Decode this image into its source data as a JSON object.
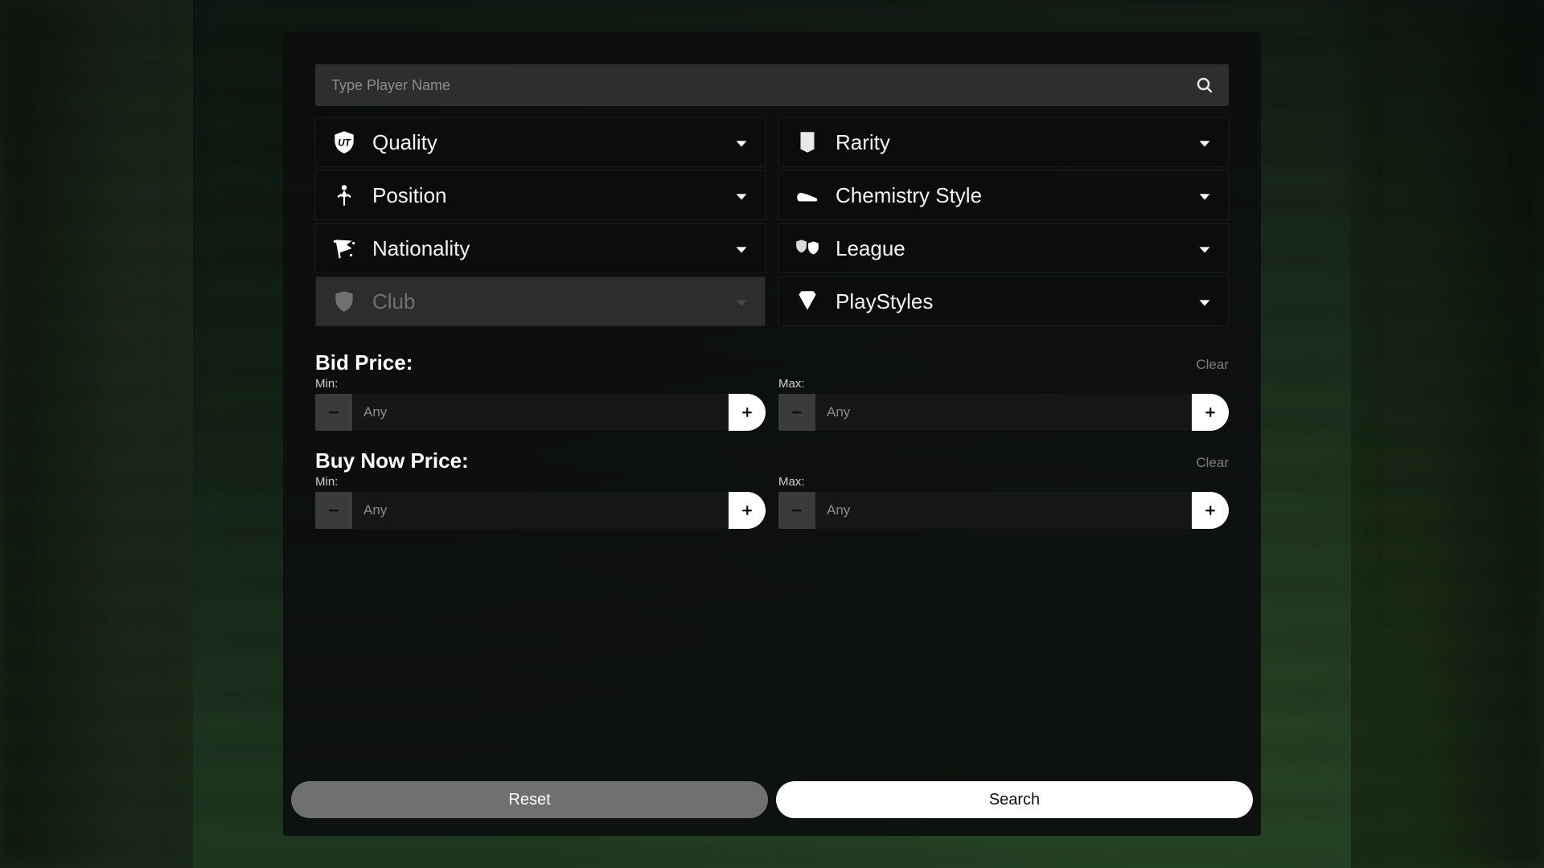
{
  "search": {
    "placeholder": "Type Player Name"
  },
  "filters": {
    "quality": {
      "label": "Quality"
    },
    "rarity": {
      "label": "Rarity"
    },
    "position": {
      "label": "Position"
    },
    "chemistry": {
      "label": "Chemistry Style"
    },
    "nationality": {
      "label": "Nationality"
    },
    "league": {
      "label": "League"
    },
    "club": {
      "label": "Club",
      "disabled": true
    },
    "playstyles": {
      "label": "PlayStyles"
    }
  },
  "bid": {
    "title": "Bid Price:",
    "clear": "Clear",
    "min_label": "Min:",
    "max_label": "Max:",
    "min_placeholder": "Any",
    "max_placeholder": "Any"
  },
  "buynow": {
    "title": "Buy Now Price:",
    "clear": "Clear",
    "min_label": "Min:",
    "max_label": "Max:",
    "min_placeholder": "Any",
    "max_placeholder": "Any"
  },
  "footer": {
    "reset": "Reset",
    "search": "Search"
  }
}
